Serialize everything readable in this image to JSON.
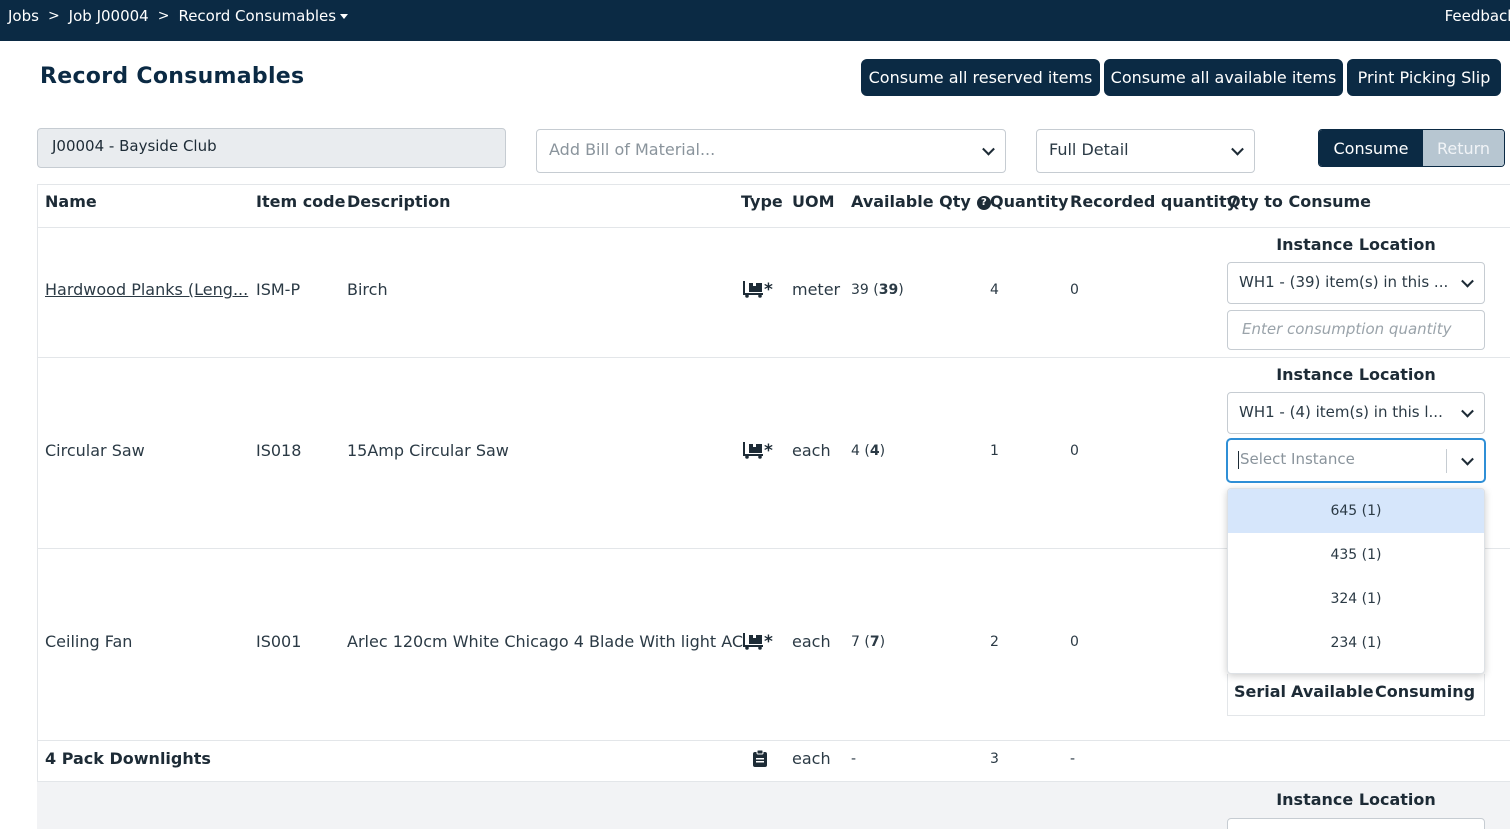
{
  "breadcrumb": {
    "jobs": "Jobs",
    "job": "Job J00004",
    "current": "Record Consumables",
    "sep": ">"
  },
  "header": {
    "feedback": "Feedback"
  },
  "page": {
    "title": "Record Consumables"
  },
  "actions": {
    "consume_reserved": "Consume all reserved items",
    "consume_available": "Consume all available items",
    "print_slip": "Print Picking Slip"
  },
  "filters": {
    "job_value": "J00004 - Bayside Club",
    "bom_placeholder": "Add Bill of Material...",
    "detail_value": "Full Detail",
    "mode_consume": "Consume",
    "mode_return": "Return"
  },
  "columns": {
    "name": "Name",
    "item_code": "Item code",
    "description": "Description",
    "type": "Type",
    "uom": "UOM",
    "available_qty": "Available Qty",
    "quantity": "Quantity",
    "recorded_quantity": "Recorded quantity",
    "qty_to_consume": "Qty to Consume"
  },
  "rows": [
    {
      "name": "Hardwood Planks (Leng...",
      "code": "ISM-P",
      "description": "Birch",
      "uom": "meter",
      "avail": "39",
      "avail_bold": "39",
      "quantity": "4",
      "recorded": "0",
      "instance_label": "Instance Location",
      "location": "WH1 - (39) item(s) in this ...",
      "qty_placeholder": "Enter consumption quantity"
    },
    {
      "name": "Circular Saw",
      "code": "IS018",
      "description": "15Amp Circular Saw",
      "uom": "each",
      "avail": "4",
      "avail_bold": "4",
      "quantity": "1",
      "recorded": "0",
      "instance_label": "Instance Location",
      "location": "WH1 - (4) item(s) in this l...",
      "instance_placeholder": "Select Instance"
    },
    {
      "name": "Ceiling Fan",
      "code": "IS001",
      "description": "Arlec 120cm White Chicago 4 Blade With light AC",
      "uom": "each",
      "avail": "7",
      "avail_bold": "7",
      "quantity": "2",
      "recorded": "0"
    },
    {
      "name": "4 Pack Downlights",
      "uom": "each",
      "avail": "-",
      "quantity": "3",
      "recorded": "-"
    }
  ],
  "instance_options": [
    "645 (1)",
    "435 (1)",
    "324 (1)",
    "234 (1)"
  ],
  "serial_table": {
    "serial": "Serial",
    "available": "Available",
    "consuming": "Consuming"
  },
  "last_row": {
    "instance_label": "Instance Location"
  },
  "icons": {
    "stock": "pallet-truck-icon",
    "kit": "clipboard-icon",
    "help": "question-circle-icon",
    "chevron": "chevron-down-icon"
  },
  "colors": {
    "navy": "#0b2a44",
    "highlight": "#d6e6fb",
    "focus": "#2f8fd6"
  }
}
